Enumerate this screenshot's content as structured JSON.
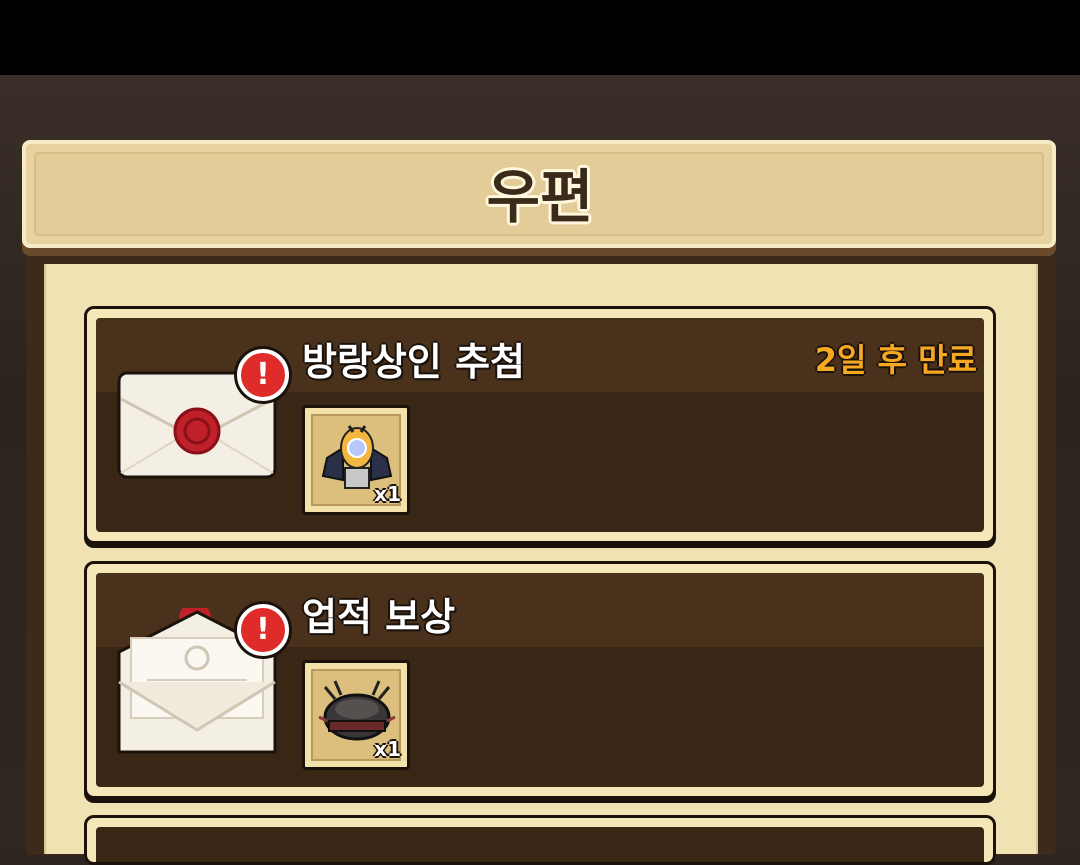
{
  "window": {
    "title": "우편"
  },
  "mails": [
    {
      "title": "방랑상인 추첨",
      "expire": "2일 후 만료",
      "alert": "!",
      "envelope": "sealed-envelope-icon",
      "items": [
        {
          "icon": "winged-lantern-icon",
          "count": "x1"
        }
      ]
    },
    {
      "title": "업적 보상",
      "expire": "",
      "alert": "!",
      "envelope": "open-envelope-icon",
      "items": [
        {
          "icon": "dark-helmet-icon",
          "count": "x1"
        }
      ]
    }
  ],
  "colors": {
    "accent": "#f6a821",
    "alert": "#e02b2b",
    "panel": "#3a2614",
    "paper": "#f0e2b3"
  }
}
